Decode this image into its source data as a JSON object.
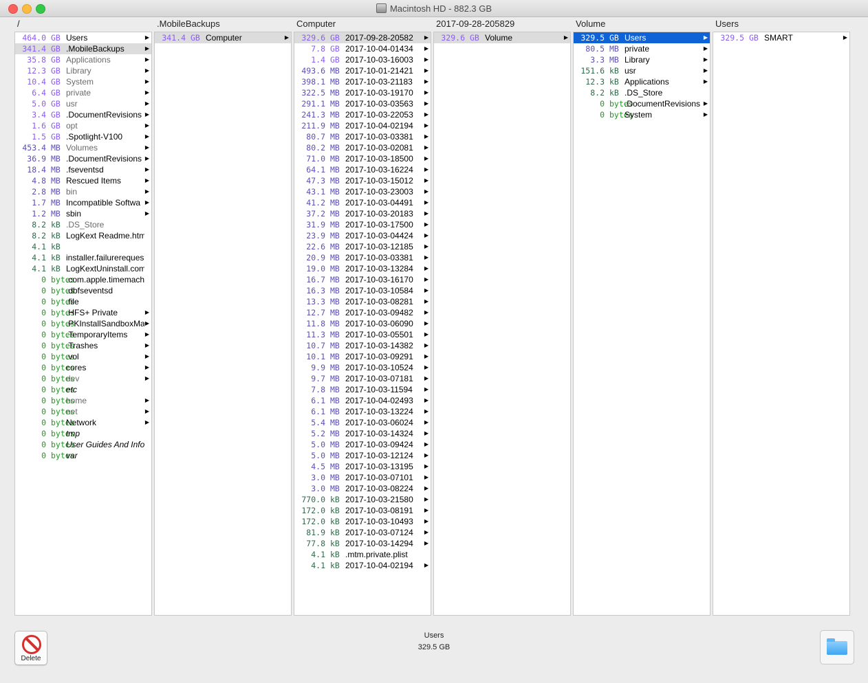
{
  "window": {
    "title": "Macintosh HD - 882.3 GB"
  },
  "columns": [
    {
      "header": "/",
      "rows": [
        {
          "size": "464.0",
          "unit": "GB",
          "name": "Users",
          "arrow": true
        },
        {
          "size": "341.4",
          "unit": "GB",
          "name": ".MobileBackups",
          "arrow": true,
          "selected": true
        },
        {
          "size": "35.8",
          "unit": "GB",
          "name": "Applications",
          "arrow": true,
          "dim": true
        },
        {
          "size": "12.3",
          "unit": "GB",
          "name": "Library",
          "arrow": true,
          "dim": true
        },
        {
          "size": "10.4",
          "unit": "GB",
          "name": "System",
          "arrow": true,
          "dim": true
        },
        {
          "size": "6.4",
          "unit": "GB",
          "name": "private",
          "arrow": true,
          "dim": true
        },
        {
          "size": "5.0",
          "unit": "GB",
          "name": "usr",
          "arrow": true,
          "dim": true
        },
        {
          "size": "3.4",
          "unit": "GB",
          "name": ".DocumentRevisions",
          "arrow": true
        },
        {
          "size": "1.6",
          "unit": "GB",
          "name": "opt",
          "arrow": true,
          "dim": true
        },
        {
          "size": "1.5",
          "unit": "GB",
          "name": ".Spotlight-V100",
          "arrow": true
        },
        {
          "size": "453.4",
          "unit": "MB",
          "name": "Volumes",
          "arrow": true,
          "dim": true
        },
        {
          "size": "36.9",
          "unit": "MB",
          "name": ".DocumentRevisions",
          "arrow": true
        },
        {
          "size": "18.4",
          "unit": "MB",
          "name": ".fseventsd",
          "arrow": true
        },
        {
          "size": "4.8",
          "unit": "MB",
          "name": "Rescued Items",
          "arrow": true
        },
        {
          "size": "2.8",
          "unit": "MB",
          "name": "bin",
          "arrow": true,
          "dim": true
        },
        {
          "size": "1.7",
          "unit": "MB",
          "name": "Incompatible Softwa",
          "arrow": true
        },
        {
          "size": "1.2",
          "unit": "MB",
          "name": "sbin",
          "arrow": true
        },
        {
          "size": "8.2",
          "unit": "kB",
          "name": ".DS_Store",
          "dim": true
        },
        {
          "size": "8.2",
          "unit": "kB",
          "name": "LogKext Readme.html"
        },
        {
          "size": "4.1",
          "unit": "kB",
          "name": ""
        },
        {
          "size": "4.1",
          "unit": "kB",
          "name": "installer.failurereques"
        },
        {
          "size": "4.1",
          "unit": "kB",
          "name": "LogKextUninstall.com"
        },
        {
          "size": "0",
          "unit": "bytes",
          "name": ".com.apple.timemach"
        },
        {
          "size": "0",
          "unit": "bytes",
          "name": ".dbfseventsd"
        },
        {
          "size": "0",
          "unit": "bytes",
          "name": ".file"
        },
        {
          "size": "0",
          "unit": "bytes",
          "name": ".HFS+ Private",
          "arrow": true
        },
        {
          "size": "0",
          "unit": "bytes",
          "name": ".PKInstallSandboxMa",
          "arrow": true
        },
        {
          "size": "0",
          "unit": "bytes",
          "name": ".TemporaryItems",
          "arrow": true
        },
        {
          "size": "0",
          "unit": "bytes",
          "name": ".Trashes",
          "arrow": true
        },
        {
          "size": "0",
          "unit": "bytes",
          "name": ".vol",
          "arrow": true
        },
        {
          "size": "0",
          "unit": "bytes",
          "name": "cores",
          "arrow": true
        },
        {
          "size": "0",
          "unit": "bytes",
          "name": "dev",
          "arrow": true,
          "dim": true
        },
        {
          "size": "0",
          "unit": "bytes",
          "name": "etc",
          "italic": true
        },
        {
          "size": "0",
          "unit": "bytes",
          "name": "home",
          "arrow": true,
          "dim": true
        },
        {
          "size": "0",
          "unit": "bytes",
          "name": "net",
          "arrow": true,
          "dim": true
        },
        {
          "size": "0",
          "unit": "bytes",
          "name": "Network",
          "arrow": true
        },
        {
          "size": "0",
          "unit": "bytes",
          "name": "tmp",
          "italic": true
        },
        {
          "size": "0",
          "unit": "bytes",
          "name": "User Guides And Inforr",
          "italic": true
        },
        {
          "size": "0",
          "unit": "bytes",
          "name": "var",
          "italic": true
        }
      ]
    },
    {
      "header": ".MobileBackups",
      "rows": [
        {
          "size": "341.4",
          "unit": "GB",
          "name": "Computer",
          "arrow": true,
          "selected": true
        }
      ]
    },
    {
      "header": "Computer",
      "rows": [
        {
          "size": "329.6",
          "unit": "GB",
          "name": "2017-09-28-20582",
          "arrow": true,
          "selected": true
        },
        {
          "size": "7.8",
          "unit": "GB",
          "name": "2017-10-04-01434",
          "arrow": true
        },
        {
          "size": "1.4",
          "unit": "GB",
          "name": "2017-10-03-16003",
          "arrow": true
        },
        {
          "size": "493.6",
          "unit": "MB",
          "name": "2017-10-01-21421",
          "arrow": true
        },
        {
          "size": "398.1",
          "unit": "MB",
          "name": "2017-10-03-21183",
          "arrow": true
        },
        {
          "size": "322.5",
          "unit": "MB",
          "name": "2017-10-03-19170",
          "arrow": true
        },
        {
          "size": "291.1",
          "unit": "MB",
          "name": "2017-10-03-03563",
          "arrow": true
        },
        {
          "size": "241.3",
          "unit": "MB",
          "name": "2017-10-03-22053",
          "arrow": true
        },
        {
          "size": "211.9",
          "unit": "MB",
          "name": "2017-10-04-02194",
          "arrow": true
        },
        {
          "size": "80.7",
          "unit": "MB",
          "name": "2017-10-03-03381",
          "arrow": true
        },
        {
          "size": "80.2",
          "unit": "MB",
          "name": "2017-10-03-02081",
          "arrow": true
        },
        {
          "size": "71.0",
          "unit": "MB",
          "name": "2017-10-03-18500",
          "arrow": true
        },
        {
          "size": "64.1",
          "unit": "MB",
          "name": "2017-10-03-16224",
          "arrow": true
        },
        {
          "size": "47.3",
          "unit": "MB",
          "name": "2017-10-03-15012",
          "arrow": true
        },
        {
          "size": "43.1",
          "unit": "MB",
          "name": "2017-10-03-23003",
          "arrow": true
        },
        {
          "size": "41.2",
          "unit": "MB",
          "name": "2017-10-03-04491",
          "arrow": true
        },
        {
          "size": "37.2",
          "unit": "MB",
          "name": "2017-10-03-20183",
          "arrow": true
        },
        {
          "size": "31.9",
          "unit": "MB",
          "name": "2017-10-03-17500",
          "arrow": true
        },
        {
          "size": "23.9",
          "unit": "MB",
          "name": "2017-10-03-04424",
          "arrow": true
        },
        {
          "size": "22.6",
          "unit": "MB",
          "name": "2017-10-03-12185",
          "arrow": true
        },
        {
          "size": "20.9",
          "unit": "MB",
          "name": "2017-10-03-03381",
          "arrow": true
        },
        {
          "size": "19.0",
          "unit": "MB",
          "name": "2017-10-03-13284",
          "arrow": true
        },
        {
          "size": "16.7",
          "unit": "MB",
          "name": "2017-10-03-16170",
          "arrow": true
        },
        {
          "size": "16.3",
          "unit": "MB",
          "name": "2017-10-03-10584",
          "arrow": true
        },
        {
          "size": "13.3",
          "unit": "MB",
          "name": "2017-10-03-08281",
          "arrow": true
        },
        {
          "size": "12.7",
          "unit": "MB",
          "name": "2017-10-03-09482",
          "arrow": true
        },
        {
          "size": "11.8",
          "unit": "MB",
          "name": "2017-10-03-06090",
          "arrow": true
        },
        {
          "size": "11.3",
          "unit": "MB",
          "name": "2017-10-03-05501",
          "arrow": true
        },
        {
          "size": "10.7",
          "unit": "MB",
          "name": "2017-10-03-14382",
          "arrow": true
        },
        {
          "size": "10.1",
          "unit": "MB",
          "name": "2017-10-03-09291",
          "arrow": true
        },
        {
          "size": "9.9",
          "unit": "MB",
          "name": "2017-10-03-10524",
          "arrow": true
        },
        {
          "size": "9.7",
          "unit": "MB",
          "name": "2017-10-03-07181",
          "arrow": true
        },
        {
          "size": "7.8",
          "unit": "MB",
          "name": "2017-10-03-11594",
          "arrow": true
        },
        {
          "size": "6.1",
          "unit": "MB",
          "name": "2017-10-04-02493",
          "arrow": true
        },
        {
          "size": "6.1",
          "unit": "MB",
          "name": "2017-10-03-13224",
          "arrow": true
        },
        {
          "size": "5.4",
          "unit": "MB",
          "name": "2017-10-03-06024",
          "arrow": true
        },
        {
          "size": "5.2",
          "unit": "MB",
          "name": "2017-10-03-14324",
          "arrow": true
        },
        {
          "size": "5.0",
          "unit": "MB",
          "name": "2017-10-03-09424",
          "arrow": true
        },
        {
          "size": "5.0",
          "unit": "MB",
          "name": "2017-10-03-12124",
          "arrow": true
        },
        {
          "size": "4.5",
          "unit": "MB",
          "name": "2017-10-03-13195",
          "arrow": true
        },
        {
          "size": "3.0",
          "unit": "MB",
          "name": "2017-10-03-07101",
          "arrow": true
        },
        {
          "size": "3.0",
          "unit": "MB",
          "name": "2017-10-03-08224",
          "arrow": true
        },
        {
          "size": "770.0",
          "unit": "kB",
          "name": "2017-10-03-21580",
          "arrow": true
        },
        {
          "size": "172.0",
          "unit": "kB",
          "name": "2017-10-03-08191",
          "arrow": true
        },
        {
          "size": "172.0",
          "unit": "kB",
          "name": "2017-10-03-10493",
          "arrow": true
        },
        {
          "size": "81.9",
          "unit": "kB",
          "name": "2017-10-03-07124",
          "arrow": true
        },
        {
          "size": "77.8",
          "unit": "kB",
          "name": "2017-10-03-14294",
          "arrow": true
        },
        {
          "size": "4.1",
          "unit": "kB",
          "name": ".mtm.private.plist"
        },
        {
          "size": "4.1",
          "unit": "kB",
          "name": "2017-10-04-02194",
          "arrow": true
        }
      ]
    },
    {
      "header": "2017-09-28-205829",
      "rows": [
        {
          "size": "329.6",
          "unit": "GB",
          "name": "Volume",
          "arrow": true,
          "selected": true
        }
      ]
    },
    {
      "header": "Volume",
      "rows": [
        {
          "size": "329.5",
          "unit": "GB",
          "name": "Users",
          "arrow": true,
          "active": true
        },
        {
          "size": "80.5",
          "unit": "MB",
          "name": "private",
          "arrow": true
        },
        {
          "size": "3.3",
          "unit": "MB",
          "name": "Library",
          "arrow": true
        },
        {
          "size": "151.6",
          "unit": "kB",
          "name": "usr",
          "arrow": true
        },
        {
          "size": "12.3",
          "unit": "kB",
          "name": "Applications",
          "arrow": true
        },
        {
          "size": "8.2",
          "unit": "kB",
          "name": ".DS_Store"
        },
        {
          "size": "0",
          "unit": "bytes",
          "name": ".DocumentRevisions",
          "arrow": true
        },
        {
          "size": "0",
          "unit": "bytes",
          "name": "System",
          "arrow": true
        }
      ]
    },
    {
      "header": "Users",
      "rows": [
        {
          "size": "329.5",
          "unit": "GB",
          "name": "SMART",
          "arrow": true
        }
      ]
    }
  ],
  "footer": {
    "delete_label": "Delete",
    "status_name": "Users",
    "status_size": "329.5 GB"
  },
  "colors": {
    "gb": "#8b5cf6",
    "mb": "#5b4fb5",
    "kb": "#2f6b4b",
    "bytes": "#1c9a1c",
    "selection_active": "#0f63d6",
    "selection_inactive": "#dcdcdc"
  },
  "icons": {
    "delete": "delete-icon",
    "folder": "folder-icon",
    "disk": "hard-disk-icon",
    "disclosure": "disclosure-arrow-icon"
  }
}
